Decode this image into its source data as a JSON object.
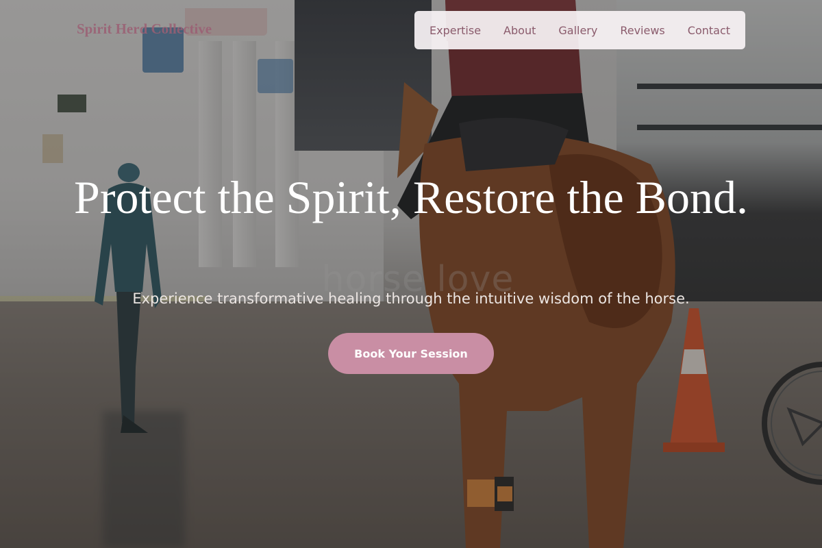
{
  "brand": {
    "name": "Spirit Herd Collective"
  },
  "nav": {
    "items": [
      {
        "label": "Expertise"
      },
      {
        "label": "About"
      },
      {
        "label": "Gallery"
      },
      {
        "label": "Reviews"
      },
      {
        "label": "Contact"
      }
    ]
  },
  "hero": {
    "title": "Protect the Spirit, Restore the Bond.",
    "subtitle": "Experience transformative healing through the intuitive wisdom of the horse.",
    "cta_label": "Book Your Session",
    "background_text": "horse love"
  },
  "colors": {
    "accent": "#c98ea4",
    "brand": "#9b5f74",
    "nav_text": "#8a5b6c",
    "nav_background": "#f8f2f4"
  }
}
